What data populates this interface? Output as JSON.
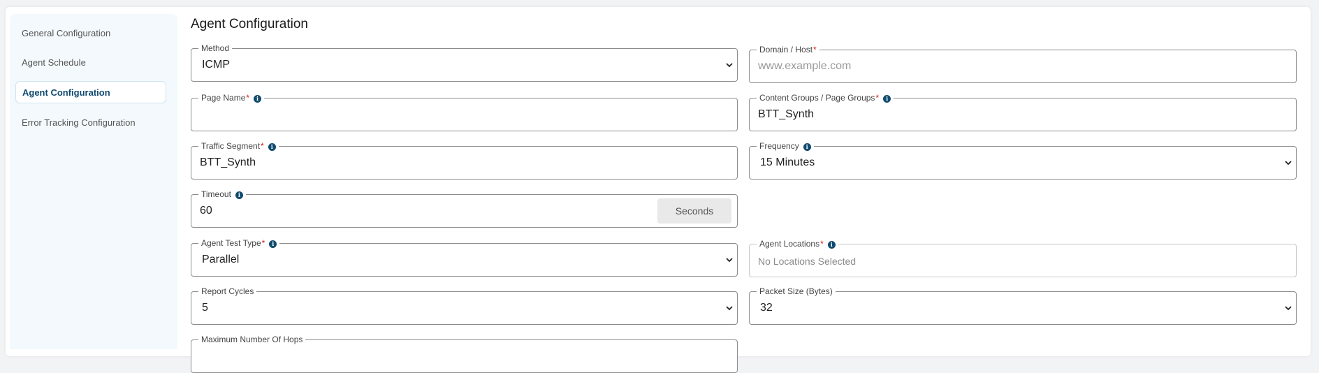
{
  "sidebar": {
    "items": [
      {
        "label": "General Configuration"
      },
      {
        "label": "Agent Schedule"
      },
      {
        "label": "Agent Configuration"
      },
      {
        "label": "Error Tracking Configuration"
      }
    ]
  },
  "page_title": "Agent Configuration",
  "form": {
    "method": {
      "label": "Method",
      "value": "ICMP"
    },
    "domain_host": {
      "label": "Domain / Host",
      "placeholder": "www.example.com"
    },
    "page_name": {
      "label": "Page Name",
      "value": ""
    },
    "content_groups": {
      "label": "Content Groups / Page Groups",
      "value": "BTT_Synth"
    },
    "traffic_segment": {
      "label": "Traffic Segment",
      "value": "BTT_Synth"
    },
    "frequency": {
      "label": "Frequency",
      "value": "15 Minutes"
    },
    "timeout": {
      "label": "Timeout",
      "value": "60",
      "suffix": "Seconds"
    },
    "agent_test_type": {
      "label": "Agent Test Type",
      "value": "Parallel"
    },
    "agent_locations": {
      "label": "Agent Locations",
      "value": "No Locations Selected"
    },
    "report_cycles": {
      "label": "Report Cycles",
      "value": "5"
    },
    "packet_size": {
      "label": "Packet Size (Bytes)",
      "value": "32"
    },
    "max_hops": {
      "label": "Maximum Number Of Hops",
      "value": ""
    }
  },
  "colors": {
    "accent": "#104a6f",
    "required": "#d11a1a",
    "sidebar_bg": "#f3f9fd"
  }
}
